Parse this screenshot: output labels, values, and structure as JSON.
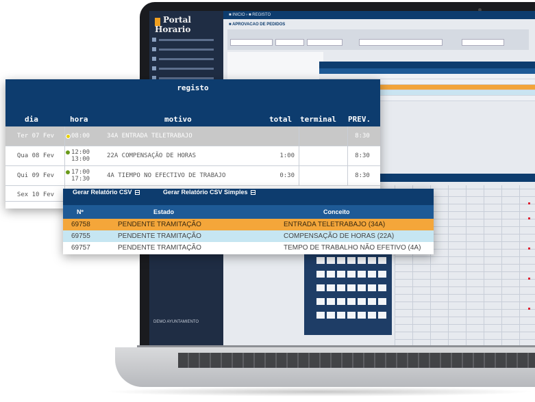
{
  "app": {
    "logo": "Portal Horario",
    "breadcrumb": "■ INICIO   ›   ■ REGISTO",
    "section_title": "■ APROVACAO DE PEDIDOS",
    "footer": "DEMO AYUNTAMIENTO"
  },
  "registo": {
    "title": "registo",
    "columns": {
      "dia": "dia",
      "hora": "hora",
      "motivo": "motivo",
      "total": "total",
      "terminal": "terminal",
      "prev": "PREV."
    },
    "rows": [
      {
        "dia": "Ter 07 Fev",
        "hora": [
          "08:00"
        ],
        "motivo": "34A ENTRADA TELETRABAJO",
        "total": "",
        "terminal": "",
        "prev": "8:30",
        "highlight": true
      },
      {
        "dia": "Qua 08 Fev",
        "hora": [
          "12:00",
          "13:00"
        ],
        "motivo": "22A COMPENSAÇÃO DE HORAS",
        "total": "1:00",
        "terminal": "",
        "prev": "8:30",
        "highlight": false
      },
      {
        "dia": "Qui 09 Fev",
        "hora": [
          "17:00",
          "17:30"
        ],
        "motivo": "4A TIEMPO NO EFECTIVO DE TRABAJO",
        "total": "0:30",
        "terminal": "",
        "prev": "8:30",
        "highlight": false
      },
      {
        "dia": "Sex 10 Fev",
        "hora": [],
        "motivo": "",
        "total": "",
        "terminal": "",
        "prev": "",
        "highlight": false
      }
    ]
  },
  "csv": {
    "link1": "Gerar Relatório CSV",
    "link2": "Gerar Relatório CSV Simples",
    "columns": {
      "n": "Nº",
      "estado": "Estado",
      "conceito": "Conceito"
    },
    "rows": [
      {
        "n": "69758",
        "estado": "PENDENTE TRAMITAÇÃO",
        "conceito": "ENTRADA TELETRABAJO (34A)",
        "tone": "orange"
      },
      {
        "n": "69755",
        "estado": "PENDENTE TRAMITAÇÃO",
        "conceito": "COMPENSAÇÃO DE HORAS (22A)",
        "tone": "lblue"
      },
      {
        "n": "69757",
        "estado": "PENDENTE TRAMITAÇÃO",
        "conceito": "TEMPO DE TRABALHO NÃO EFETIVO (4A)",
        "tone": "white"
      }
    ]
  },
  "colors": {
    "header_dark": "#0d3c6e",
    "header_mid": "#1e5a96",
    "row_orange": "#f4a63a",
    "row_light_blue": "#c6e6f2",
    "row_highlight_grey": "#c8c8c8",
    "status_dot": "#6a9a1a"
  },
  "icons": {
    "csv_link": "table-icon",
    "time_marker": "dot-icon"
  }
}
